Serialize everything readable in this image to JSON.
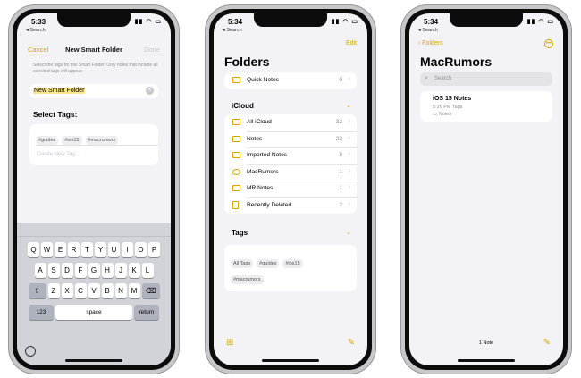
{
  "status": {
    "time": "5:33",
    "time2": "5:34",
    "back_label": "Search"
  },
  "phone1": {
    "nav": {
      "cancel": "Cancel",
      "title": "New Smart Folder",
      "done": "Done"
    },
    "hint": "Select the tags for this Smart Folder. Only notes that include all selected tags will appear.",
    "name_value": "New Smart Folder",
    "select_tags_heading": "Select Tags:",
    "tags": [
      "#guides",
      "#ios15",
      "#macrumors"
    ],
    "create_placeholder": "Create New Tag...",
    "keyboard": {
      "row1": [
        "Q",
        "W",
        "E",
        "R",
        "T",
        "Y",
        "U",
        "I",
        "O",
        "P"
      ],
      "row2": [
        "A",
        "S",
        "D",
        "F",
        "G",
        "H",
        "J",
        "K",
        "L"
      ],
      "row3": [
        "Z",
        "X",
        "C",
        "V",
        "B",
        "N",
        "M"
      ],
      "numbers": "123",
      "space": "space",
      "return": "return"
    }
  },
  "phone2": {
    "edit": "Edit",
    "title": "Folders",
    "quick_notes": {
      "label": "Quick Notes",
      "count": "0"
    },
    "icloud_heading": "iCloud",
    "folders": [
      {
        "label": "All iCloud",
        "count": "32"
      },
      {
        "label": "Notes",
        "count": "23"
      },
      {
        "label": "Imported Notes",
        "count": "8"
      },
      {
        "label": "MacRumors",
        "count": "1"
      },
      {
        "label": "MR Notes",
        "count": "1"
      },
      {
        "label": "Recently Deleted",
        "count": "2"
      }
    ],
    "tags_heading": "Tags",
    "tags": [
      "All Tags",
      "#guides",
      "#ios15",
      "#macrumors"
    ]
  },
  "phone3": {
    "back": "Folders",
    "title": "MacRumors",
    "search_placeholder": "Search",
    "note": {
      "title": "iOS 15 Notes",
      "meta": "5:26 PM  Tags",
      "folder": "Notes"
    },
    "count": "1 Note"
  },
  "colors": {
    "accent": "#d7a700",
    "background": "#f2f2f7"
  }
}
